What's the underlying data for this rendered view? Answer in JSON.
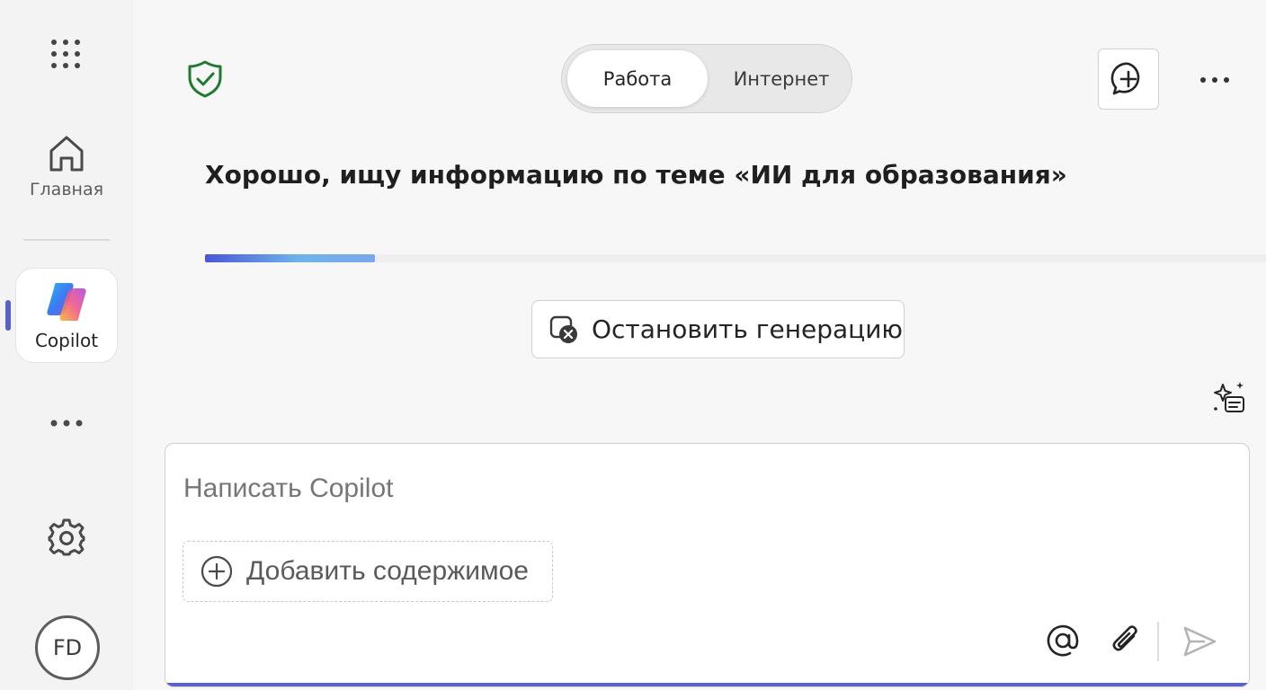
{
  "nav": {
    "apps_icon": "grid-dots-icon",
    "home_label": "Главная",
    "home_icon": "home-icon",
    "copilot_label": "Copilot",
    "copilot_icon": "copilot-logo",
    "more_icon": "more-horizontal-icon",
    "settings_icon": "gear-icon",
    "avatar_initials": "FD",
    "accent_color": "#5b5fc7"
  },
  "header": {
    "shield_icon": "shield-check-icon",
    "shield_color": "#1f7a2e",
    "toggle": {
      "options": [
        "Работа",
        "Интернет"
      ],
      "selected": "Работа"
    },
    "new_chat_icon": "chat-add-icon",
    "more_icon": "more-horizontal-icon"
  },
  "chat": {
    "status_message": "Хорошо, ищу информацию по теме «ИИ для образования»",
    "progress_fraction": 0.16,
    "stop_button_label": "Остановить генерацию",
    "stop_icon": "stop-generation-icon",
    "prompts_icon": "sparkle-prompts-icon"
  },
  "composer": {
    "placeholder": "Написать Copilot",
    "add_content_label": "Добавить содержимое",
    "add_icon": "add-circle-icon",
    "mention_icon": "at-mention-icon",
    "attach_icon": "paperclip-icon",
    "send_icon": "send-icon"
  }
}
